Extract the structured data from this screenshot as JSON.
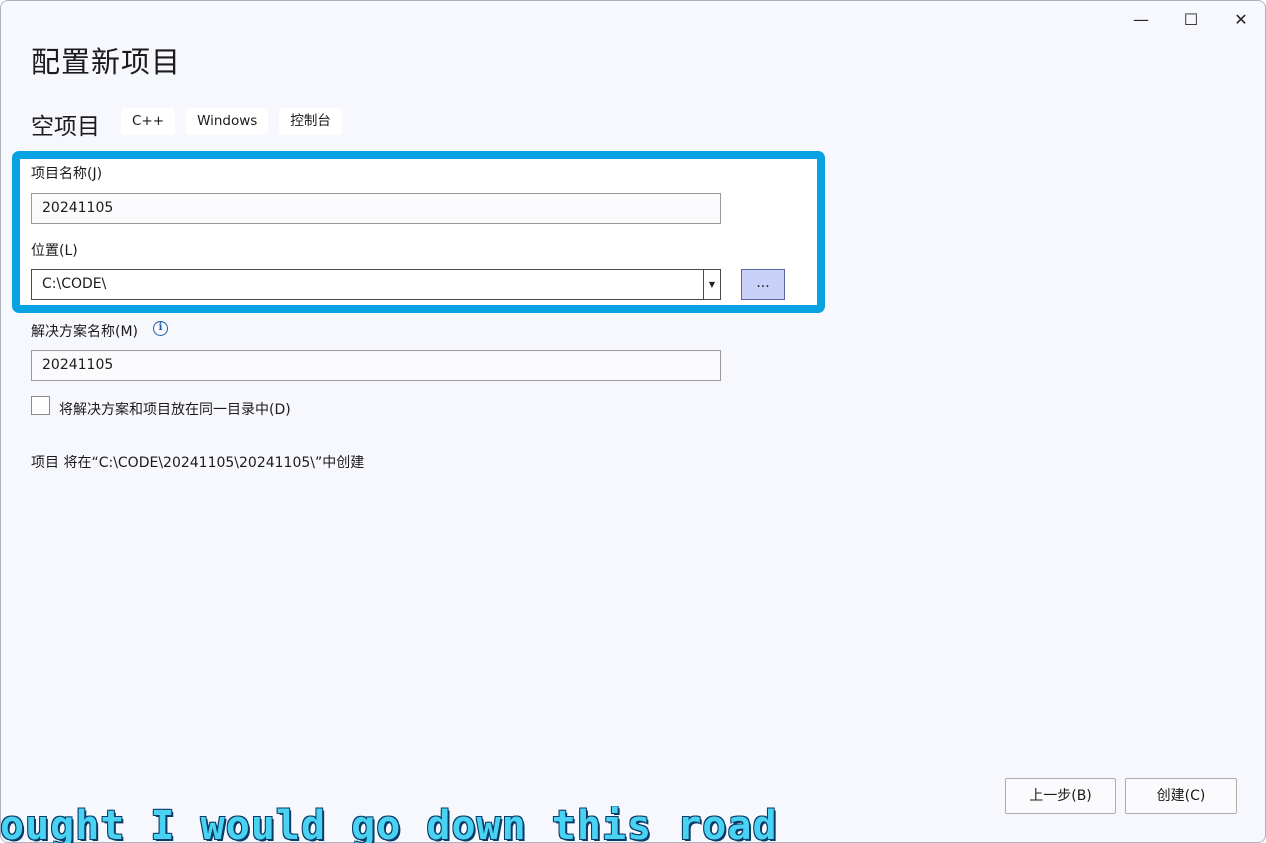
{
  "window": {
    "controls": {
      "minimize": "—",
      "maximize": "☐",
      "close": "✕"
    }
  },
  "page": {
    "title": "配置新项目",
    "project_type": "空项目",
    "tags": [
      "C++",
      "Windows",
      "控制台"
    ]
  },
  "form": {
    "project_name_label": "项目名称(J)",
    "project_name_value": "20241105",
    "location_label": "位置(L)",
    "location_value": "C:\\CODE\\",
    "browse_label": "...",
    "solution_name_label": "解决方案名称(M)",
    "solution_name_value": "20241105",
    "same_dir_checkbox_label": "将解决方案和项目放在同一目录中(D)",
    "same_dir_checked": false,
    "info_icon": "info-icon",
    "creation_path_text": "项目 将在“C:\\CODE\\20241105\\20241105\\”中创建"
  },
  "footer": {
    "back_label": "上一步(B)",
    "create_label": "创建(C)"
  },
  "overlay": {
    "caption": "ought I would go down this road"
  },
  "colors": {
    "highlight_border": "#08a2e2",
    "window_bg": "#f7f8fd",
    "browse_bg": "#c9d1f8"
  }
}
